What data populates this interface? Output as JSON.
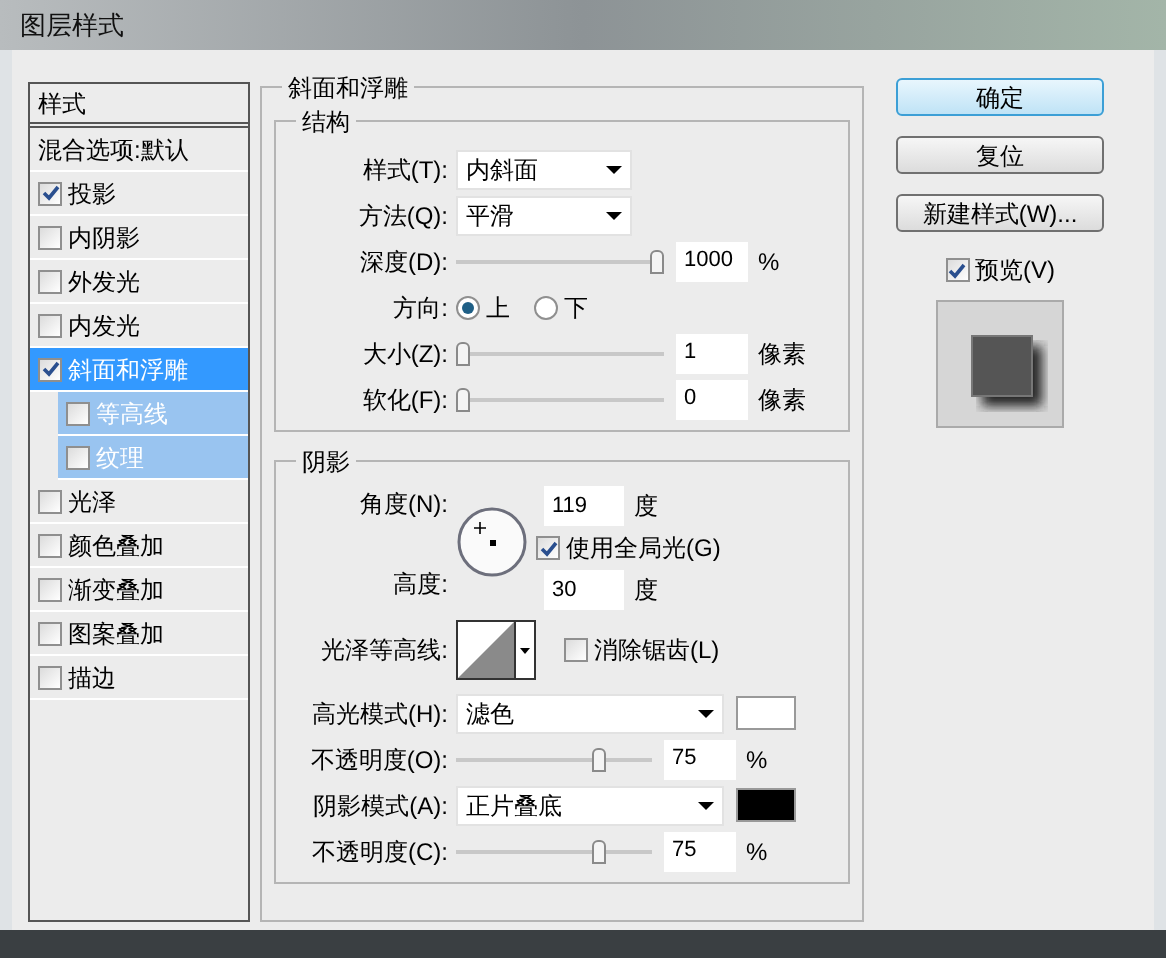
{
  "window": {
    "title": "图层样式"
  },
  "sidebar": {
    "items": [
      {
        "kind": "header",
        "label": "样式"
      },
      {
        "kind": "plain",
        "label": "混合选项:默认",
        "selected": false
      },
      {
        "kind": "check",
        "label": "投影",
        "checked": true,
        "selected": false
      },
      {
        "kind": "check",
        "label": "内阴影",
        "checked": false,
        "selected": false
      },
      {
        "kind": "check",
        "label": "外发光",
        "checked": false,
        "selected": false
      },
      {
        "kind": "check",
        "label": "内发光",
        "checked": false,
        "selected": false
      },
      {
        "kind": "check",
        "label": "斜面和浮雕",
        "checked": true,
        "selected": true,
        "children": [
          {
            "kind": "check",
            "label": "等高线",
            "checked": false,
            "selected": false
          },
          {
            "kind": "check",
            "label": "纹理",
            "checked": false,
            "selected": false
          }
        ]
      },
      {
        "kind": "check",
        "label": "光泽",
        "checked": false,
        "selected": false
      },
      {
        "kind": "check",
        "label": "颜色叠加",
        "checked": false,
        "selected": false
      },
      {
        "kind": "check",
        "label": "渐变叠加",
        "checked": false,
        "selected": false
      },
      {
        "kind": "check",
        "label": "图案叠加",
        "checked": false,
        "selected": false
      },
      {
        "kind": "check",
        "label": "描边",
        "checked": false,
        "selected": false
      }
    ]
  },
  "panel": {
    "title": "斜面和浮雕",
    "structure": {
      "title": "结构",
      "style": {
        "label": "样式(T):",
        "value": "内斜面"
      },
      "technique": {
        "label": "方法(Q):",
        "value": "平滑"
      },
      "depth": {
        "label": "深度(D):",
        "level": 1.0,
        "value": "1000",
        "unit": "%"
      },
      "direction": {
        "label": "方向:",
        "options": [
          {
            "label": "上",
            "selected": true
          },
          {
            "label": "下",
            "selected": false
          }
        ]
      },
      "size": {
        "label": "大小(Z):",
        "level": 0,
        "value": "1",
        "unit": "像素"
      },
      "soften": {
        "label": "软化(F):",
        "level": 0,
        "value": "0",
        "unit": "像素"
      }
    },
    "shading": {
      "title": "阴影",
      "angle": {
        "label": "角度(N):",
        "value": "119",
        "unit": "度"
      },
      "global_light": {
        "label": "使用全局光(G)",
        "checked": true
      },
      "altitude": {
        "label": "高度:",
        "value": "30",
        "unit": "度"
      },
      "gloss_contour": {
        "label": "光泽等高线:"
      },
      "anti_aliased": {
        "label": "消除锯齿(L)",
        "checked": false
      },
      "highlight_mode": {
        "label": "高光模式(H):",
        "value": "滤色",
        "color": "#ffffff"
      },
      "highlight_opacity": {
        "label": "不透明度(O):",
        "level": 0.75,
        "value": "75",
        "unit": "%"
      },
      "shadow_mode": {
        "label": "阴影模式(A):",
        "value": "正片叠底",
        "color": "#000000"
      },
      "shadow_opacity": {
        "label": "不透明度(C):",
        "level": 0.75,
        "value": "75",
        "unit": "%"
      }
    }
  },
  "buttons": [
    {
      "label": "确定",
      "default": true
    },
    {
      "label": "复位",
      "default": false
    },
    {
      "label": "新建样式(W)...",
      "default": false
    }
  ],
  "preview": {
    "label": "预览(V)",
    "checked": true
  }
}
